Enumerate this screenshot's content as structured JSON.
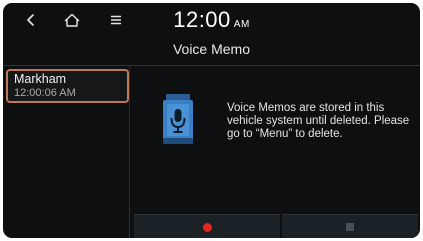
{
  "header": {
    "time": "12:00",
    "ampm": "AM",
    "title": "Voice Memo"
  },
  "nav": {
    "back_icon": "chevron-left-icon",
    "home_icon": "home-icon",
    "menu_icon": "menu-icon"
  },
  "memos": [
    {
      "name": "Markham",
      "time": "12:00:06 AM",
      "selected": true
    }
  ],
  "content": {
    "message": "Voice Memos are stored in this vehicle system until deleted. Please go to “Menu” to delete.",
    "icon": "voice-memo-icon"
  },
  "controls": {
    "record_icon": "record-icon",
    "stop_icon": "stop-icon",
    "record_color": "#e32525"
  },
  "colors": {
    "background": "#0d0f11",
    "selection_border": "#c0785a",
    "accent_blue": "#3a7fc4"
  }
}
